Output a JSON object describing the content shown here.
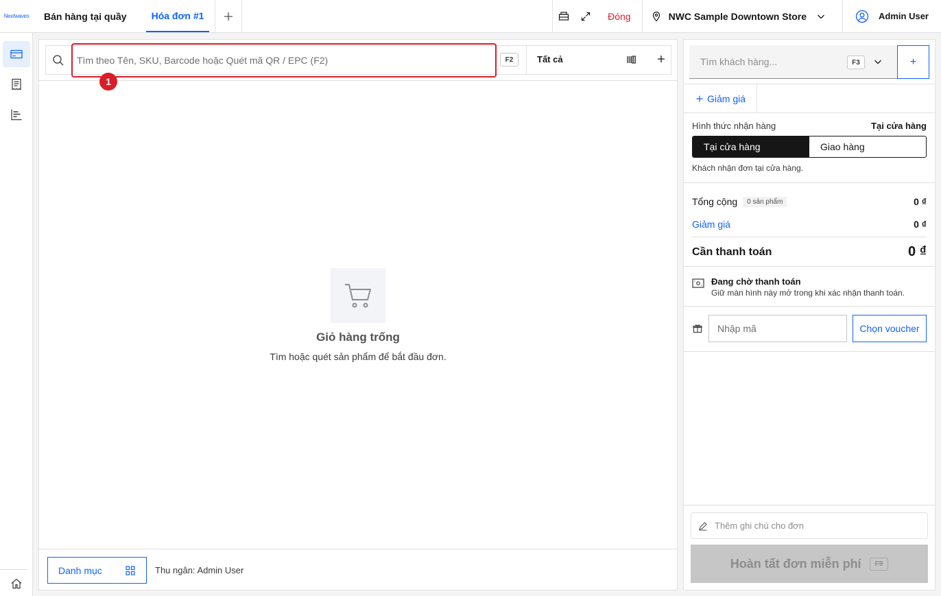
{
  "header": {
    "logo_text": "Nextwaves",
    "app_title": "Bán hàng tại quầy",
    "tabs": [
      {
        "label": "Hóa đơn #1"
      }
    ],
    "close_label": "Đóng",
    "store_name": "NWC Sample Downtown Store",
    "user_name": "Admin User"
  },
  "search": {
    "placeholder": "Tìm theo Tên, SKU, Barcode hoặc Quét mã QR / EPC (F2)",
    "shortcut": "F2",
    "filter_label": "Tất cả",
    "marker_number": "1"
  },
  "cart": {
    "empty_title": "Giỏ hàng trống",
    "empty_subtitle": "Tìm hoặc quét sản phẩm để bắt đầu đơn."
  },
  "footer": {
    "category_label": "Danh mục",
    "cashier": "Thu ngân: Admin User"
  },
  "customer": {
    "placeholder": "Tìm khách hàng...",
    "shortcut": "F3",
    "add_label": "+"
  },
  "discount": {
    "button_label": "Giảm giá"
  },
  "delivery": {
    "label": "Hình thức nhận hàng",
    "selected_value": "Tại cửa hàng",
    "options": [
      "Tại cửa hàng",
      "Giao hàng"
    ],
    "note": "Khách nhận đơn tại cửa hàng."
  },
  "summary": {
    "total_label": "Tổng cộng",
    "item_count": "0 sản phẩm",
    "total_value": "0 ₫",
    "discount_label": "Giảm giá",
    "discount_value": "0 ₫",
    "payable_label": "Cần thanh toán",
    "payable_value": "0 ₫"
  },
  "payment_status": {
    "title": "Đang chờ thanh toán",
    "subtitle": "Giữ màn hình này mở trong khi xác nhận thanh toán."
  },
  "voucher": {
    "placeholder": "Nhập mã",
    "button_label": "Chọn voucher"
  },
  "order_note": {
    "placeholder": "Thêm ghi chú cho đơn"
  },
  "finish": {
    "label": "Hoàn tất đơn miễn phí",
    "shortcut": "F9"
  },
  "colors": {
    "accent": "#0f62fe",
    "danger": "#da1e28",
    "dark": "#161616"
  }
}
